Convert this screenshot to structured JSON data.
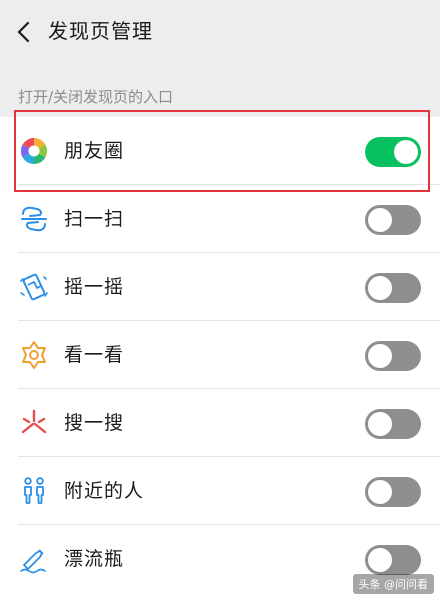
{
  "header": {
    "title": "发现页管理"
  },
  "section": {
    "label": "打开/关闭发现页的入口"
  },
  "items": [
    {
      "label": "朋友圈",
      "icon": "moments-icon",
      "enabled": true
    },
    {
      "label": "扫一扫",
      "icon": "scan-icon",
      "enabled": false
    },
    {
      "label": "摇一摇",
      "icon": "shake-icon",
      "enabled": false
    },
    {
      "label": "看一看",
      "icon": "top-stories-icon",
      "enabled": false
    },
    {
      "label": "搜一搜",
      "icon": "search-icon",
      "enabled": false
    },
    {
      "label": "附近的人",
      "icon": "people-nearby-icon",
      "enabled": false
    },
    {
      "label": "漂流瓶",
      "icon": "drift-bottle-icon",
      "enabled": false
    }
  ],
  "colors": {
    "toggle_on": "#07c160",
    "toggle_off": "#8e8e8e",
    "highlight": "#e3333b",
    "icon_blue": "#2b8fe6",
    "icon_orange": "#f0a02f",
    "icon_red": "#e54e4e"
  },
  "watermark": {
    "text": "头条 @问问看"
  }
}
